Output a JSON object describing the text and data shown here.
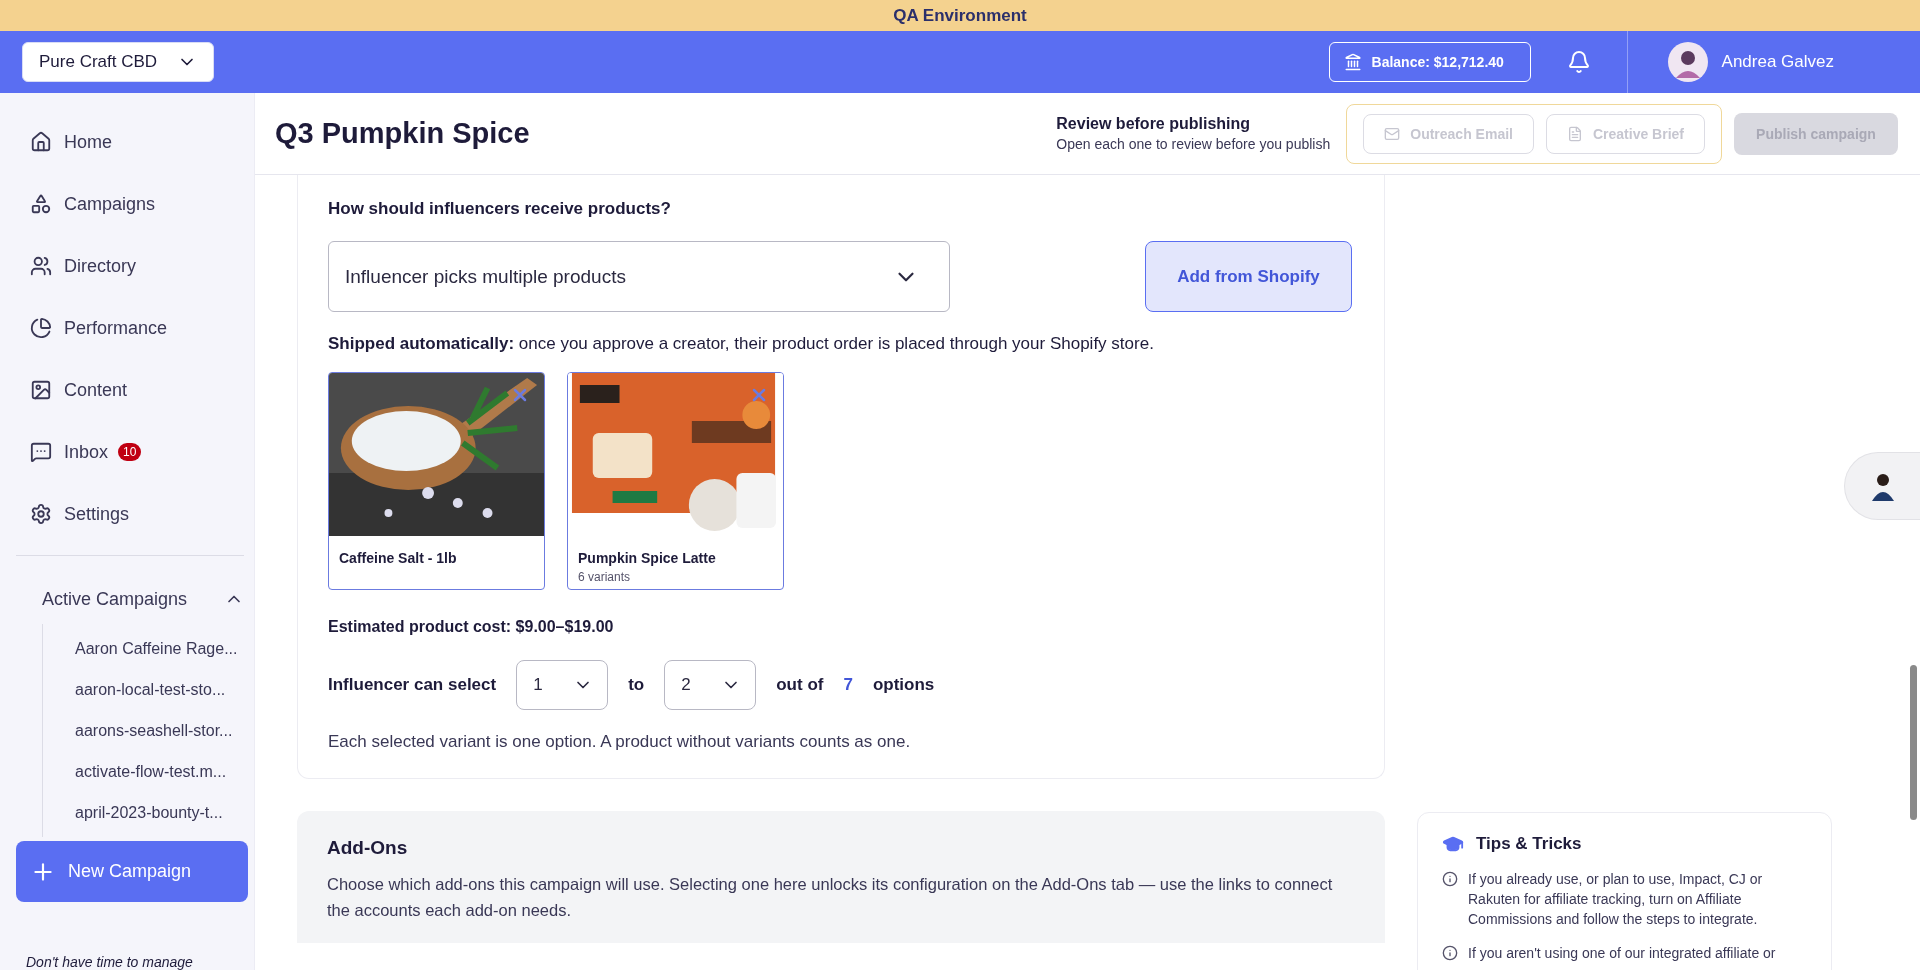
{
  "environment_banner": "QA Environment",
  "header": {
    "store_selector": "Pure Craft CBD",
    "balance": "Balance: $12,712.40",
    "user_name": "Andrea Galvez"
  },
  "sidebar": {
    "items": [
      {
        "label": "Home"
      },
      {
        "label": "Campaigns"
      },
      {
        "label": "Directory"
      },
      {
        "label": "Performance"
      },
      {
        "label": "Content"
      },
      {
        "label": "Inbox",
        "badge": "10"
      },
      {
        "label": "Settings"
      }
    ],
    "active_campaigns": {
      "title": "Active Campaigns",
      "expanded": true,
      "items": [
        "Aaron Caffeine Rage...",
        "aaron-local-test-sto...",
        "aarons-seashell-stor...",
        "activate-flow-test.m...",
        "april-2023-bounty-t..."
      ]
    },
    "new_campaign_button": "New Campaign",
    "footer_text": "Don't have time to manage"
  },
  "page": {
    "title": "Q3 Pumpkin Spice",
    "review_title": "Review before publishing",
    "review_subtitle": "Open each one to review before you publish",
    "review_buttons": [
      {
        "label": "Outreach Email",
        "disabled": true
      },
      {
        "label": "Creative Brief",
        "disabled": true
      }
    ],
    "publish_button": {
      "label": "Publish campaign",
      "disabled": true
    }
  },
  "products": {
    "question": "How should influencers receive products?",
    "delivery_select": "Influencer picks multiple products",
    "add_button": "Add from Shopify",
    "shipping_note": "**Shipped automatically:** once you approve a creator, their product order is placed through your Shopify store.",
    "items": [
      {
        "name": "Caffeine Salt - 1lb"
      },
      {
        "name": "Pumpkin Spice Latte",
        "variants": "6 variants"
      }
    ],
    "estimated_cost": "Estimated product cost: $9.00–$19.00",
    "selection": {
      "label": "Influencer can select",
      "min": "1",
      "to": "to",
      "max": "2",
      "out_of": "out of",
      "total": "7",
      "options": "options"
    },
    "selection_note": "Each selected variant is one option. A product without variants counts as one."
  },
  "add_ons": {
    "title": "Add-Ons",
    "description": "Choose which add-ons this campaign will use. Selecting one here unlocks its configuration on the Add-Ons tab — use the links to connect the accounts each add-on needs."
  },
  "tips": {
    "title": "Tips & Tricks",
    "items": [
      "If you already use, or plan to use, Impact, CJ or Rakuten for affiliate tracking, turn on Affiliate Commissions and follow the steps to integrate.",
      "If you aren't using one of our integrated affiliate or"
    ]
  }
}
